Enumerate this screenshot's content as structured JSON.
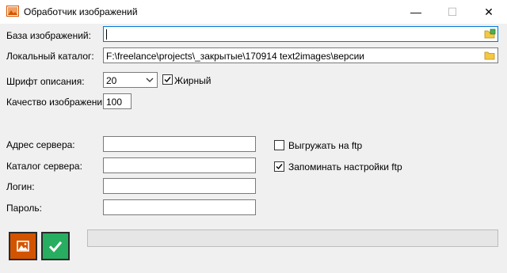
{
  "window": {
    "title": "Обработчик изображений",
    "min_glyph": "—",
    "max_glyph": "☐",
    "close_glyph": "✕"
  },
  "form": {
    "image_base": {
      "label": "База изображений:",
      "value": ""
    },
    "local_dir": {
      "label": "Локальный каталог:",
      "value": "F:\\freelance\\projects\\_закрытые\\170914 text2images\\версии"
    },
    "font": {
      "label": "Шрифт описания:",
      "size_value": "20",
      "bold_label": "Жирный",
      "bold_checked": true
    },
    "quality": {
      "label": "Качество изображений:",
      "value": "100"
    }
  },
  "ftp": {
    "server_address": {
      "label": "Адрес сервера:",
      "value": ""
    },
    "server_dir": {
      "label": "Каталог сервера:",
      "value": ""
    },
    "login": {
      "label": "Логин:",
      "value": ""
    },
    "password": {
      "label": "Пароль:",
      "value": ""
    },
    "upload_ftp": {
      "label": "Выгружать на ftp",
      "checked": false
    },
    "remember_ftp": {
      "label": "Запоминать настройки ftp",
      "checked": true
    }
  },
  "actions": {
    "image_button_icon": "image-icon",
    "run_button_icon": "checkmark-icon"
  },
  "progress": {
    "fraction": 0
  },
  "colors": {
    "image_button": "#d35400",
    "run_button": "#27ae60",
    "focus_border": "#0078d7",
    "folder_yellow": "#f5c842"
  }
}
